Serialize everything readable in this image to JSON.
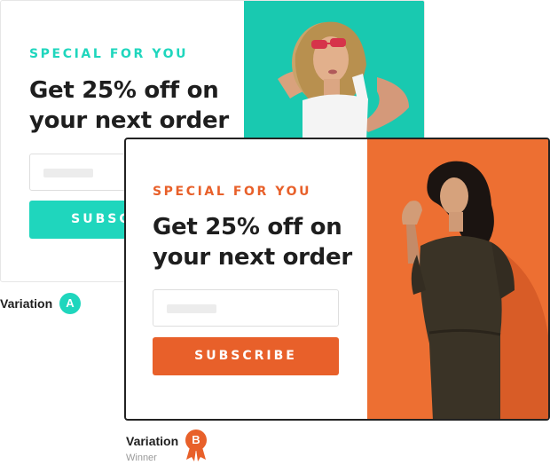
{
  "variation_a": {
    "eyebrow": "SPECIAL FOR YOU",
    "headline_line1": "Get 25% off on",
    "headline_line2": "your next order",
    "button_label": "SUBSCRIBE",
    "label": "Variation",
    "badge": "A",
    "accent_color": "#1fd6bd",
    "photo_background": "#19c9b0"
  },
  "variation_b": {
    "eyebrow": "SPECIAL FOR YOU",
    "headline_line1": "Get 25% off on",
    "headline_line2": "your next order",
    "button_label": "SUBSCRIBE",
    "label": "Variation",
    "badge": "B",
    "status": "Winner",
    "accent_color": "#e8602a",
    "photo_background": "#ec6b2f",
    "winner_icon": "ribbon-badge-icon"
  }
}
